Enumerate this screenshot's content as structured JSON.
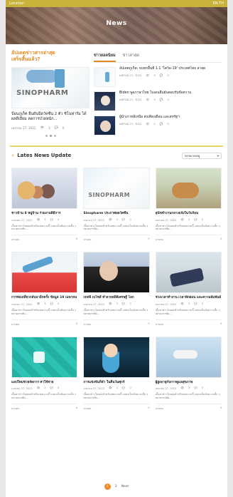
{
  "topbar": {
    "location": "Location",
    "lang": "EN TH"
  },
  "hero": {
    "title": "News"
  },
  "featured": {
    "section_title": "อัปเดตข่าวสารล่าสุด",
    "section_subtitle": "เสร็จสิ้นแล้ว?",
    "image_brand": "SINOPHARM",
    "title": "ป้อนภูเก็ต ยืนยันฉีดวัคซีน 2 ตัว ซิโนฟาร์ม ได้ผลดีเยี่ยม ลดการป่วยหนัก...",
    "date": "เมษายน 27, 2022",
    "views": "3",
    "comments": "0"
  },
  "tabs": [
    {
      "label": "ข่าวยอดนิยม",
      "active": true
    },
    {
      "label": "ข่าวล่าสุด",
      "active": false
    }
  ],
  "sidebar_feed": [
    {
      "title": "อัปเดตภูเก็ต: จบทุกพื้นที่ 1.1 'โควิด-19' ประเทศไทย ล่าสุด",
      "date": "เมษายน 27, 2022",
      "views": "3",
      "comments": "0"
    },
    {
      "title": "Biden พูดภาษาไทย ไบเดนยืนยันตอบรับข้อความ",
      "date": "เมษายน 27, 2022",
      "views": "3",
      "comments": "0"
    },
    {
      "title": "ผู้นำเกาหลีเหนือ ส่งเสียงเตือน และสหรัฐฯ",
      "date": "เมษายน 27, 2022",
      "views": "2",
      "comments": "0"
    }
  ],
  "latest": {
    "header": "Lates News Update",
    "select_value": "ทุกหมวดหมู่"
  },
  "grid": [
    {
      "title": "ชาวบ้าน 8 หมู่บ้าน ร่วมงานพิธีการ",
      "date": "เมษายน 27, 2022",
      "views": "3",
      "comments": "0",
      "excerpt": "เนื้อหาข่าวโดยย่อสำหรับบทความนี้ แสดงเป็นข้อความสั้น ๆ หลายบรรทัด...",
      "foot_left": "อ่านต่อ",
      "foot_right": "0"
    },
    {
      "title": "Sinopharm ประกาศผลวัคซีน",
      "date": "เมษายน 27, 2022",
      "views": "3",
      "comments": "0",
      "excerpt": "เนื้อหาข่าวโดยย่อสำหรับบทความนี้ แสดงเป็นข้อความสั้น ๆ หลายบรรทัด...",
      "foot_left": "อ่านต่อ",
      "foot_right": "0"
    },
    {
      "title": "สุนัขทำงานกลางแจ้งในวันร้อน",
      "date": "เมษายน 27, 2022",
      "views": "3",
      "comments": "0",
      "excerpt": "เนื้อหาข่าวโดยย่อสำหรับบทความนี้ แสดงเป็นข้อความสั้น ๆ หลายบรรทัด...",
      "foot_left": "อ่านต่อ",
      "foot_right": "0"
    },
    {
      "title": "การท่องเที่ยวกลับมาอีกครั้ง ข้อมูล 19 เมษายน",
      "date": "เมษายน 27, 2022",
      "views": "3",
      "comments": "0",
      "excerpt": "เนื้อหาข่าวโดยย่อสำหรับบทความนี้ แสดงเป็นข้อความสั้น ๆ หลายบรรทัด...",
      "foot_left": "อ่านต่อ",
      "foot_right": "0"
    },
    {
      "title": "เจฟฟ์ เบโซส์ ทำลายสถิติเศรษฐี โลก",
      "date": "เมษายน 27, 2022",
      "views": "3",
      "comments": "0",
      "excerpt": "เนื้อหาข่าวโดยย่อสำหรับบทความนี้ แสดงเป็นข้อความสั้น ๆ หลายบรรทัด...",
      "foot_left": "อ่านต่อ",
      "foot_right": "0"
    },
    {
      "title": "ช่วงเวลาทำงาน เวลาพักผ่อน และความสัมพันธ์",
      "date": "เมษายน 27, 2022",
      "views": "3",
      "comments": "0",
      "excerpt": "เนื้อหาข่าวโดยย่อสำหรับบทความนี้ แสดงเป็นข้อความสั้น ๆ หลายบรรทัด...",
      "foot_left": "อ่านต่อ",
      "foot_right": "0"
    },
    {
      "title": "แอปใหม่ช่วยจัดการ ค่าใช้จ่าย",
      "date": "เมษายน 27, 2022",
      "views": "3",
      "comments": "0",
      "excerpt": "เนื้อหาข่าวโดยย่อสำหรับบทความนี้ แสดงเป็นข้อความสั้น ๆ หลายบรรทัด...",
      "foot_left": "อ่านต่อ",
      "foot_right": "0"
    },
    {
      "title": "การแข่งขันกีฬา ในคืนวันศุกร์",
      "date": "เมษายน 27, 2022",
      "views": "3",
      "comments": "0",
      "excerpt": "เนื้อหาข่าวโดยย่อสำหรับบทความนี้ แสดงเป็นข้อความสั้น ๆ หลายบรรทัด...",
      "foot_left": "อ่านต่อ",
      "foot_right": "0"
    },
    {
      "title": "ผู้สูงอายุกับการดูแลสุขภาพ",
      "date": "เมษายน 27, 2022",
      "views": "3",
      "comments": "0",
      "excerpt": "เนื้อหาข่าวโดยย่อสำหรับบทความนี้ แสดงเป็นข้อความสั้น ๆ หลายบรรทัด...",
      "foot_left": "อ่านต่อ",
      "foot_right": "0"
    }
  ],
  "pager": {
    "current": "1",
    "next": "2",
    "next_label": "Next"
  }
}
